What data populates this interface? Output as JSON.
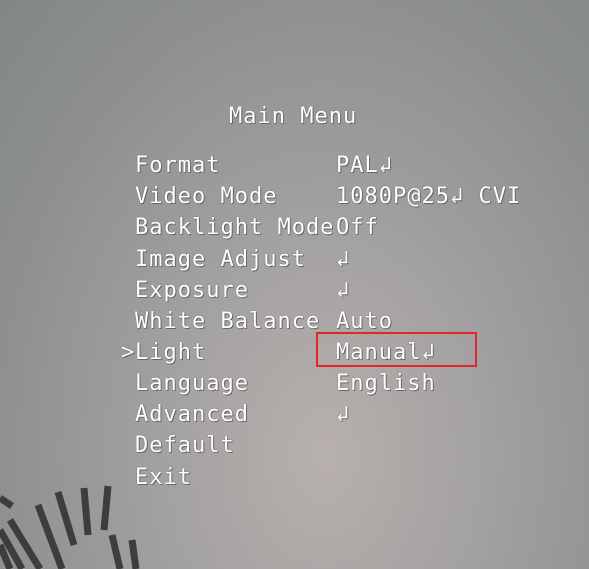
{
  "menu": {
    "title": "Main Menu",
    "cursor": ">",
    "items": [
      {
        "label": "Format",
        "value": "PAL↲"
      },
      {
        "label": "Video Mode",
        "value": "1080P@25↲ CVI"
      },
      {
        "label": "Backlight Mode",
        "value": "Off"
      },
      {
        "label": "Image Adjust",
        "value": "↲"
      },
      {
        "label": "Exposure",
        "value": "↲"
      },
      {
        "label": "White Balance",
        "value": "Auto"
      },
      {
        "label": "Light",
        "value": "Manual↲"
      },
      {
        "label": "Language",
        "value": "English"
      },
      {
        "label": "Advanced",
        "value": "↲"
      },
      {
        "label": "Default",
        "value": ""
      },
      {
        "label": "Exit",
        "value": ""
      }
    ]
  },
  "highlight_color": "#e3262b"
}
